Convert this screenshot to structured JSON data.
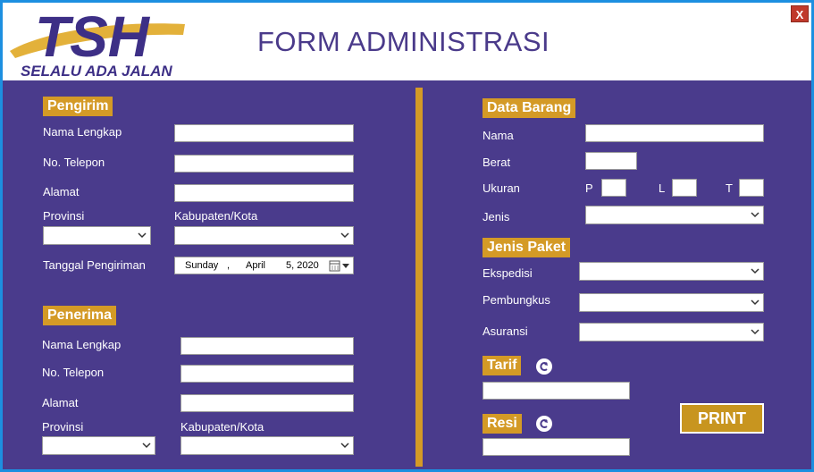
{
  "header": {
    "logo_text": "TSH",
    "logo_tagline": "SELALU ADA JALAN",
    "title": "FORM ADMINISTRASI",
    "close_label": "X"
  },
  "pengirim": {
    "section_label": "Pengirim",
    "nama_label": "Nama Lengkap",
    "telepon_label": "No. Telepon",
    "alamat_label": "Alamat",
    "provinsi_label": "Provinsi",
    "kabupaten_label": "Kabupaten/Kota",
    "tanggal_label": "Tanggal Pengiriman",
    "date_day": "Sunday",
    "date_sep": ",",
    "date_month": "April",
    "date_daynum_year": "5, 2020"
  },
  "penerima": {
    "section_label": "Penerima",
    "nama_label": "Nama Lengkap",
    "telepon_label": "No. Telepon",
    "alamat_label": "Alamat",
    "provinsi_label": "Provinsi",
    "kabupaten_label": "Kabupaten/Kota"
  },
  "barang": {
    "section_label": "Data Barang",
    "nama_label": "Nama",
    "berat_label": "Berat",
    "ukuran_label": "Ukuran",
    "p_label": "P",
    "l_label": "L",
    "t_label": "T",
    "jenis_label": "Jenis"
  },
  "paket": {
    "section_label": "Jenis Paket",
    "ekspedisi_label": "Ekspedisi",
    "pembungkus_label": "Pembungkus",
    "asuransi_label": "Asuransi"
  },
  "tarif": {
    "section_label": "Tarif"
  },
  "resi": {
    "section_label": "Resi"
  },
  "actions": {
    "print_label": "PRINT"
  },
  "colors": {
    "panel": "#4a3b8c",
    "accent": "#d49a26",
    "title": "#4a3a8a",
    "border": "#1d8fe0"
  }
}
